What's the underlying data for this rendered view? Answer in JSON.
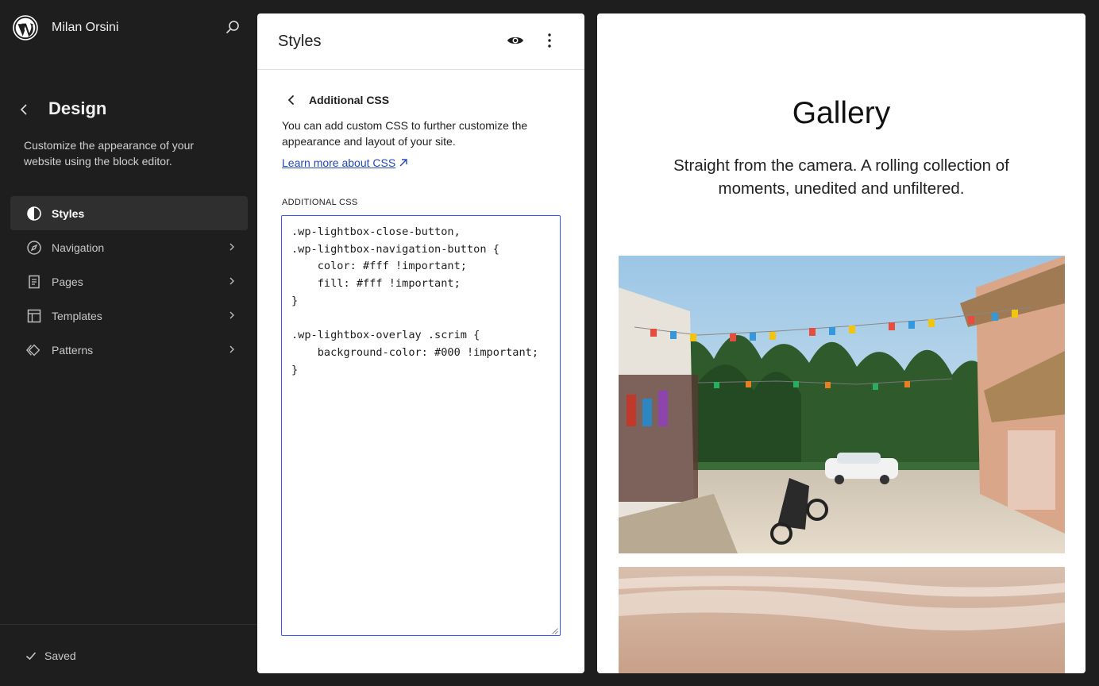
{
  "site": {
    "name": "Milan Orsini",
    "logo_icon": "wordpress-logo-icon"
  },
  "sidebar": {
    "title": "Design",
    "description": "Customize the appearance of your website using the block editor.",
    "items": [
      {
        "label": "Styles",
        "icon": "half-circle-icon",
        "active": true
      },
      {
        "label": "Navigation",
        "icon": "compass-icon",
        "active": false
      },
      {
        "label": "Pages",
        "icon": "page-icon",
        "active": false
      },
      {
        "label": "Templates",
        "icon": "layout-icon",
        "active": false
      },
      {
        "label": "Patterns",
        "icon": "symbol-icon",
        "active": false
      }
    ],
    "status": "Saved"
  },
  "panel": {
    "title": "Styles",
    "section_title": "Additional CSS",
    "description": "You can add custom CSS to further customize the appearance and layout of your site.",
    "learn_more": "Learn more about CSS",
    "field_label": "ADDITIONAL CSS",
    "css_value": ".wp-lightbox-close-button,\n.wp-lightbox-navigation-button {\n    color: #fff !important;\n    fill: #fff !important;\n}\n\n.wp-lightbox-overlay .scrim {\n    background-color: #000 !important;\n}"
  },
  "preview": {
    "title": "Gallery",
    "subtitle": "Straight from the camera. A rolling collection of moments, unedited and unfiltered."
  },
  "colors": {
    "accent": "#3858e9",
    "link": "#2548b8",
    "sidebar_bg": "#1e1e1e",
    "active_bg": "#2f2f2f"
  }
}
